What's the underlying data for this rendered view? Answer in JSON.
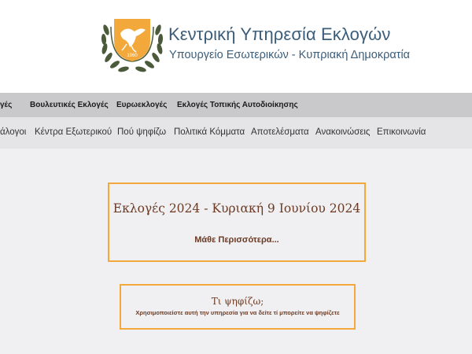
{
  "header": {
    "title": "Κεντρική Υπηρεσία Εκλογών",
    "subtitle": "Υπουργείο Εσωτερικών - Κυπριακή Δημοκρατία",
    "logo_year": "1960"
  },
  "nav_primary": {
    "items": [
      {
        "label": "γές"
      },
      {
        "label": "Βουλευτικές Εκλογές"
      },
      {
        "label": "Ευρωεκλογές"
      },
      {
        "label": "Εκλογές Τοπικής Αυτοδιοίκησης"
      }
    ]
  },
  "nav_secondary": {
    "items": [
      {
        "label": "άλογοι"
      },
      {
        "label": "Κέντρα Εξωτερικού"
      },
      {
        "label": "Πού ψηφίζω"
      },
      {
        "label": "Πολιτικά Κόμματα"
      },
      {
        "label": "Αποτελέσματα"
      },
      {
        "label": "Ανακοινώσεις"
      },
      {
        "label": "Επικοινωνία"
      }
    ]
  },
  "election_card": {
    "title": "Εκλογές 2024 - Κυριακή 9 Ιουνίου 2024",
    "link": "Μάθε Περισσότερα..."
  },
  "vote_card": {
    "title": "Τι ψηφίζω;",
    "description": "Χρησιμοποιείστε αυτή την υπηρεσία για να δείτε τί μπορείτε να ψηφίζετε"
  },
  "colors": {
    "accent_orange": "#f2a83a",
    "title_blue": "#3b5d7a",
    "card_text_brown": "#6b3a24",
    "nav_primary_bg": "#c9c9cb",
    "nav_secondary_bg": "#e5e5e7",
    "page_bg": "#f0f0f2",
    "olive_green": "#4a5a3a"
  }
}
